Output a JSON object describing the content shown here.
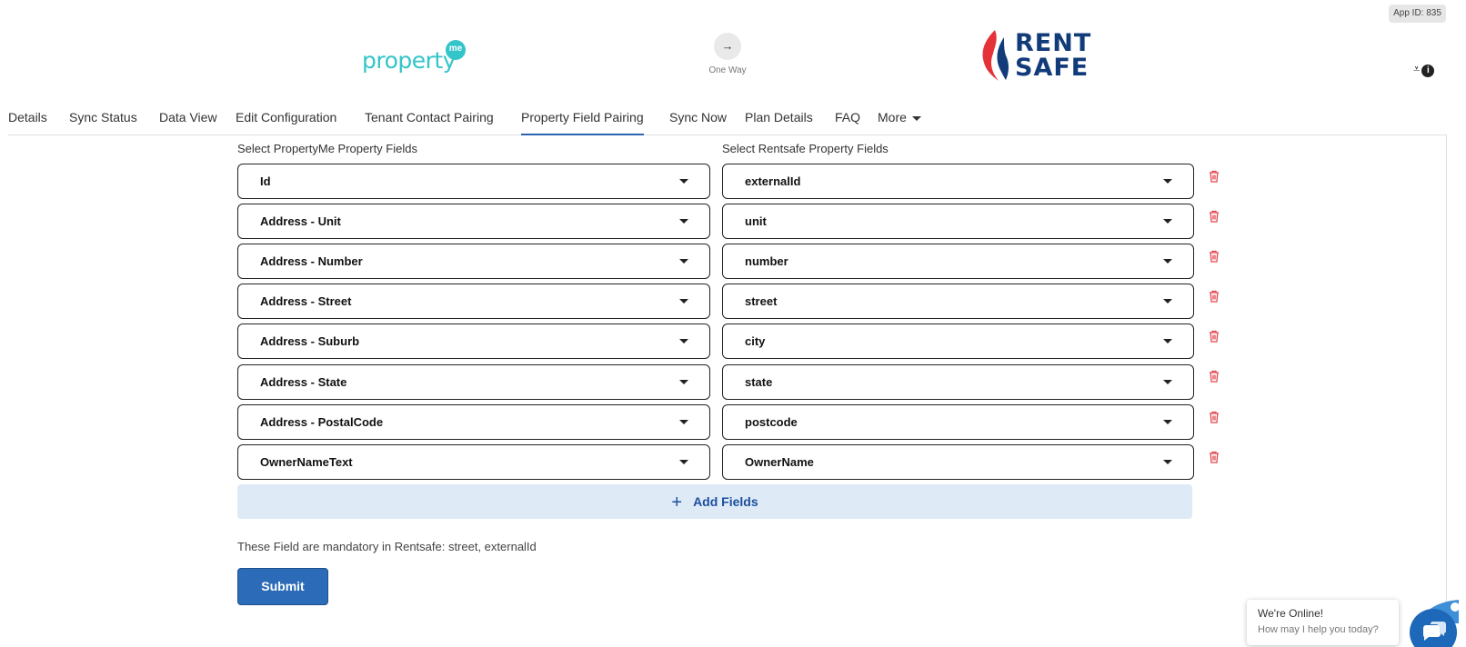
{
  "app_id": "App ID: 835",
  "header": {
    "source_logo_text": "property",
    "source_logo_badge": "me",
    "sync_direction": "One Way",
    "target_logo_line1": "RENT",
    "target_logo_line2": "SAFE"
  },
  "tabs": [
    {
      "label": "Details"
    },
    {
      "label": "Sync Status"
    },
    {
      "label": "Data View"
    },
    {
      "label": "Edit Configuration"
    },
    {
      "label": "Tenant Contact Pairing"
    },
    {
      "label": "Property Field Pairing",
      "active": true
    },
    {
      "label": "Sync Now"
    },
    {
      "label": "Plan Details"
    },
    {
      "label": "FAQ"
    },
    {
      "label": "More"
    }
  ],
  "pairing": {
    "left_label": "Select PropertyMe Property Fields",
    "right_label": "Select Rentsafe Property Fields",
    "rows": [
      {
        "left": "Id",
        "right": "externalId"
      },
      {
        "left": "Address - Unit",
        "right": "unit"
      },
      {
        "left": "Address - Number",
        "right": "number"
      },
      {
        "left": "Address - Street",
        "right": "street"
      },
      {
        "left": "Address - Suburb",
        "right": "city"
      },
      {
        "left": "Address - State",
        "right": "state"
      },
      {
        "left": "Address - PostalCode",
        "right": "postcode"
      },
      {
        "left": "OwnerNameText",
        "right": "OwnerName"
      }
    ],
    "add_label": "Add Fields",
    "note": "These Field are mandatory in Rentsafe: street, externalId",
    "submit_label": "Submit"
  },
  "chat": {
    "title": "We're Online!",
    "subtitle": "How may I help you today?"
  },
  "colors": {
    "accent": "#2b6bb8",
    "tab_underline": "#2b63b1",
    "delete": "#e0474c",
    "add_bg": "#dfeaf7",
    "propertyme_teal": "#33c5c9",
    "rentsafe_navy": "#123b7a"
  }
}
